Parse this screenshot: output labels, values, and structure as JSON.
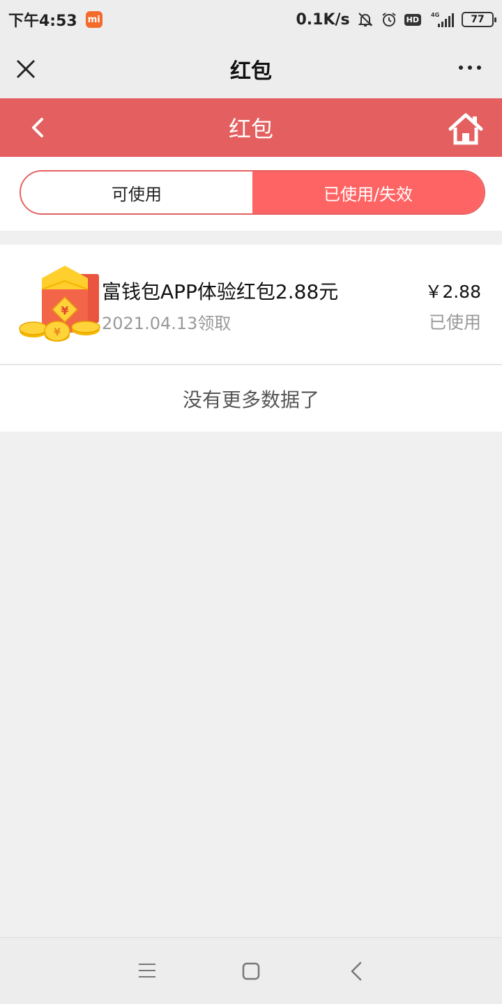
{
  "status_bar": {
    "time": "下午4:53",
    "speed": "0.1K/s",
    "hd": "HD",
    "network": "4G",
    "battery": "77"
  },
  "wechat_bar": {
    "title": "红包"
  },
  "header": {
    "title": "红包"
  },
  "tabs": [
    {
      "label": "可使用",
      "active": false
    },
    {
      "label": "已使用/失效",
      "active": true
    }
  ],
  "items": [
    {
      "title": "富钱包APP体验红包2.88元",
      "date": "2021.04.13领取",
      "amount": "￥2.88",
      "status": "已使用"
    }
  ],
  "no_more": "没有更多数据了",
  "colors": {
    "accent_red": "#e45f5f",
    "tab_active": "#ff6464"
  }
}
